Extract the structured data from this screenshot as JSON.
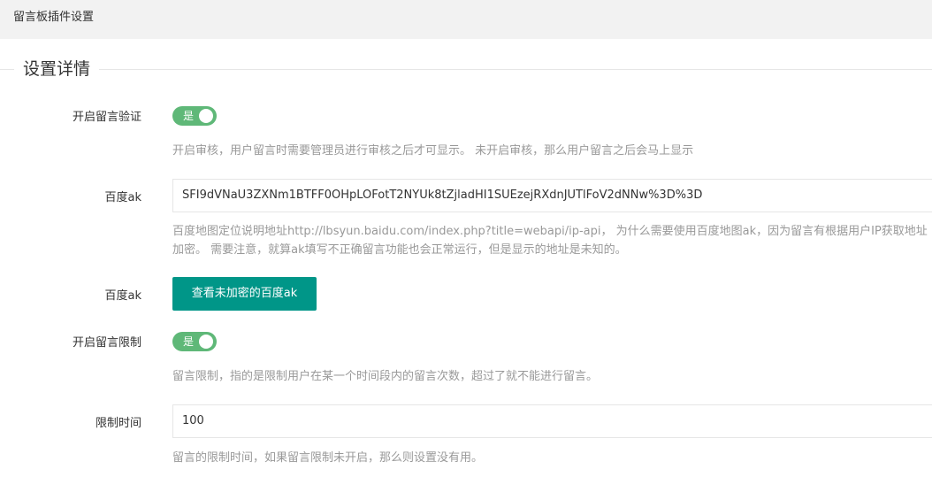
{
  "header": {
    "title": "留言板插件设置"
  },
  "section": {
    "legend": "设置详情"
  },
  "fields": {
    "verify": {
      "label": "开启留言验证",
      "toggle_text": "是",
      "help": "开启审核，用户留言时需要管理员进行审核之后才可显示。 未开启审核，那么用户留言之后会马上显示"
    },
    "baidu_ak": {
      "label": "百度ak",
      "value": "SFI9dVNaU3ZXNm1BTFF0OHpLOFotT2NYUk8tZjladHI1SUEzejRXdnJUTlFoV2dNNw%3D%3D",
      "help_line1": "百度地图定位说明地址http://lbsyun.baidu.com/index.php?title=webapi/ip-api， 为什么需要使用百度地图ak，因为留言有根据用户IP获取地址",
      "help_line2": "加密。 需要注意，就算ak填写不正确留言功能也会正常运行，但是显示的地址是未知的。"
    },
    "baidu_ak_view": {
      "label": "百度ak",
      "button": "查看未加密的百度ak"
    },
    "limit": {
      "label": "开启留言限制",
      "toggle_text": "是",
      "help": "留言限制，指的是限制用户在某一个时间段内的留言次数，超过了就不能进行留言。"
    },
    "limit_time": {
      "label": "限制时间",
      "value": "100",
      "help": "留言的限制时间，如果留言限制未开启，那么则设置没有用。"
    }
  },
  "colors": {
    "switch_on": "#5fb878",
    "button": "#009688",
    "help_text": "#999999"
  }
}
